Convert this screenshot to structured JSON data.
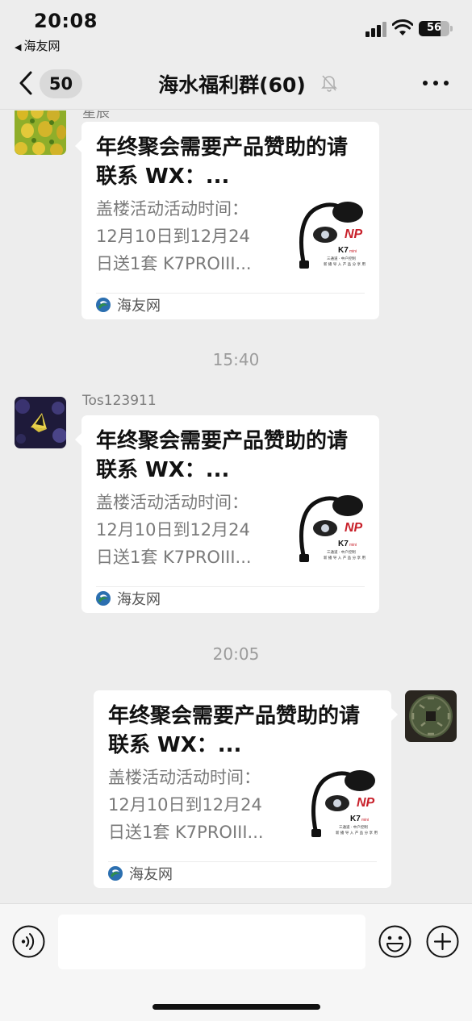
{
  "status_bar": {
    "time": "20:08",
    "back_app": "海友网",
    "battery": "56"
  },
  "nav": {
    "back_count": "50",
    "title": "海水福利群(60)"
  },
  "messages": [
    {
      "sender": "星辰",
      "title": "年终聚会需要产品赞助的请联系 WX：...",
      "desc_lines": [
        "盖楼活动活动时间：",
        "12月10日到12月24",
        "日送1套 K7PROIII..."
      ],
      "source": "海友网"
    },
    {
      "sender": "Tos123911",
      "title": "年终聚会需要产品赞助的请联系 WX：...",
      "desc_lines": [
        "盖楼活动活动时间：",
        "12月10日到12月24",
        "日送1套 K7PROIII..."
      ],
      "source": "海友网"
    },
    {
      "title": "年终聚会需要产品赞助的请联系 WX：...",
      "desc_lines": [
        "盖楼活动活动时间：",
        "12月10日到12月24",
        "日送1套 K7PROIII..."
      ],
      "source": "海友网"
    }
  ],
  "timestamps": [
    "15:40",
    "20:05"
  ],
  "thumbnail_text": {
    "brand": "NP",
    "model": "K7",
    "model_suffix": "mini",
    "line1": "三通道 · 中户控制",
    "line2": "新 播 导 入 产 品 分 享 用 户"
  },
  "colors": {
    "background": "#ededed",
    "card": "#ffffff",
    "input_bar": "#f6f6f6",
    "muted_text": "#7a7a7a",
    "logo_green": "#2f8d4e",
    "logo_blue": "#2b6fb0"
  }
}
